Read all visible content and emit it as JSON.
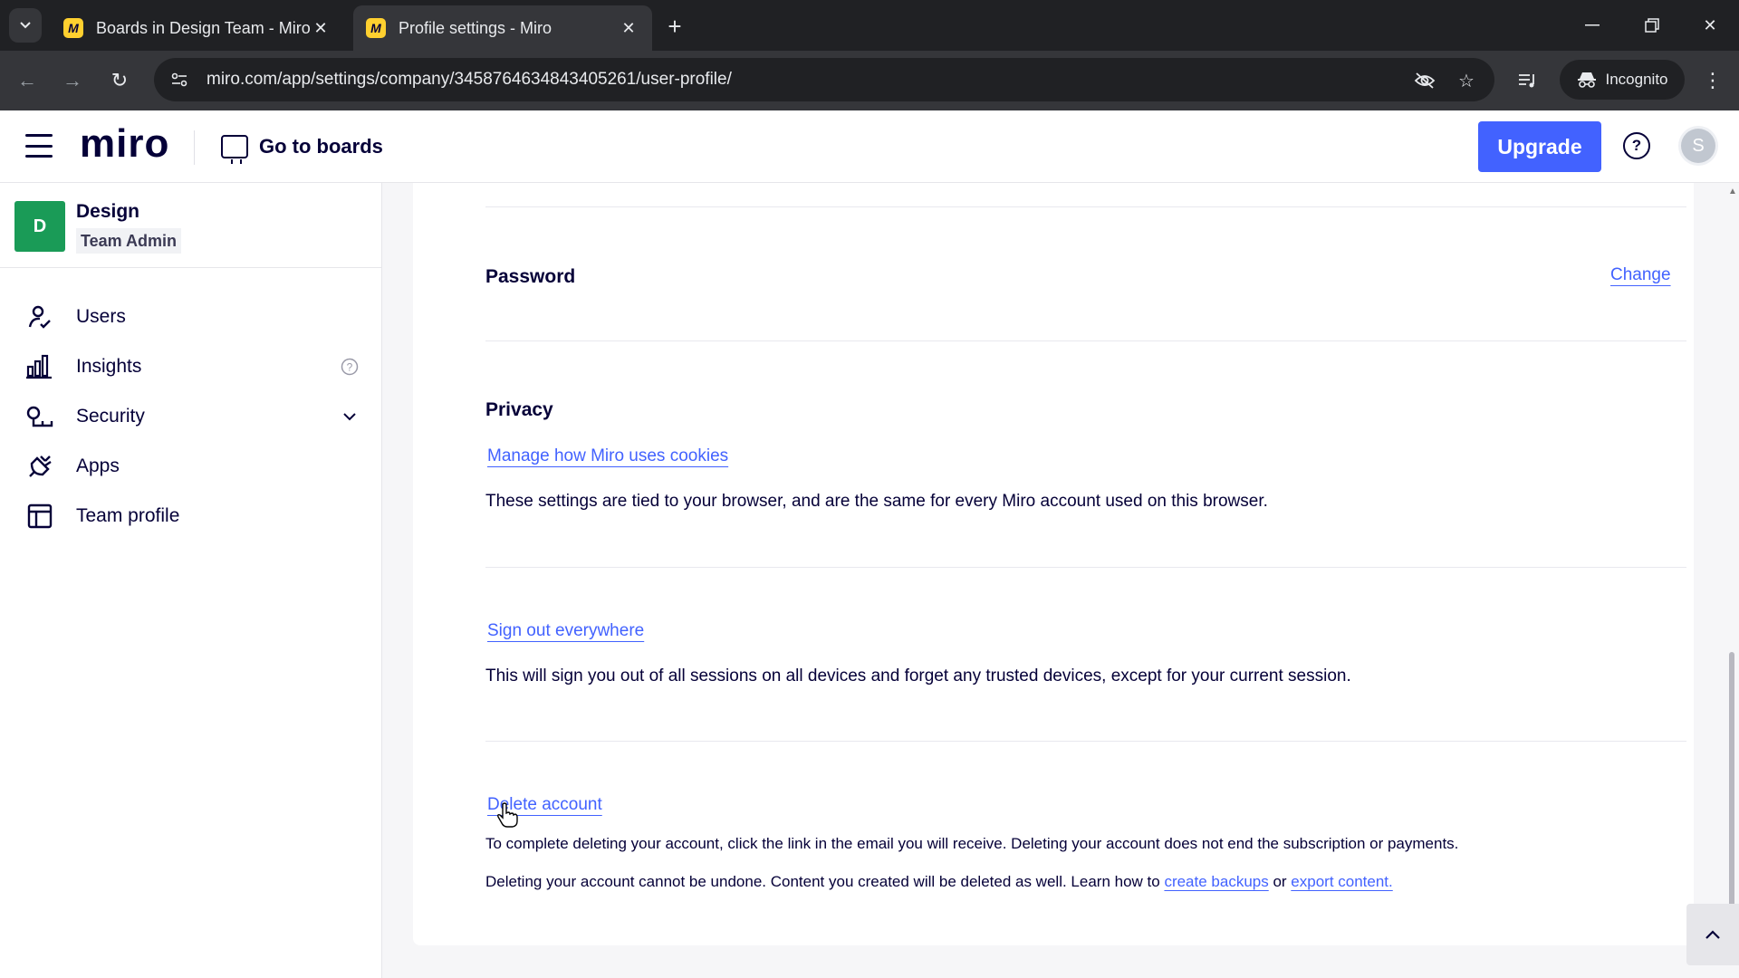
{
  "browser": {
    "tabs": [
      {
        "title": "Boards in Design Team - Miro",
        "active": false
      },
      {
        "title": "Profile settings - Miro",
        "active": true
      }
    ],
    "url": "miro.com/app/settings/company/3458764634843405261/user-profile/",
    "incognito_label": "Incognito"
  },
  "header": {
    "logo": "miro",
    "go_to_boards": "Go to boards",
    "upgrade": "Upgrade",
    "avatar_initial": "S",
    "help_symbol": "?"
  },
  "sidebar": {
    "team_initial": "D",
    "team_name": "Design",
    "team_role": "Team Admin",
    "items": [
      {
        "label": "Users",
        "icon": "user-icon"
      },
      {
        "label": "Insights",
        "icon": "bar-chart-icon"
      },
      {
        "label": "Security",
        "icon": "key-icon"
      },
      {
        "label": "Apps",
        "icon": "plug-icon"
      },
      {
        "label": "Team profile",
        "icon": "layout-icon"
      }
    ]
  },
  "main": {
    "password": {
      "title": "Password",
      "change_label": "Change"
    },
    "privacy": {
      "title": "Privacy",
      "cookies_link": "Manage how Miro uses cookies",
      "cookies_desc": "These settings are tied to your browser, and are the same for every Miro account used on this browser."
    },
    "sign_out": {
      "link": "Sign out everywhere",
      "desc": "This will sign you out of all sessions on all devices and forget any trusted devices, except for your current session."
    },
    "delete": {
      "link": "Delete account",
      "desc1": "To complete deleting your account, click the link in the email you will receive. Deleting your account does not end the subscription or payments.",
      "desc2_prefix": "Deleting your account cannot be undone. Content you created will be deleted as well. Learn how to ",
      "backups_link": "create backups",
      "or_text": " or ",
      "export_link": "export content."
    }
  },
  "colors": {
    "accent": "#4262ff",
    "text": "#050038",
    "team_badge": "#1a9b57"
  }
}
